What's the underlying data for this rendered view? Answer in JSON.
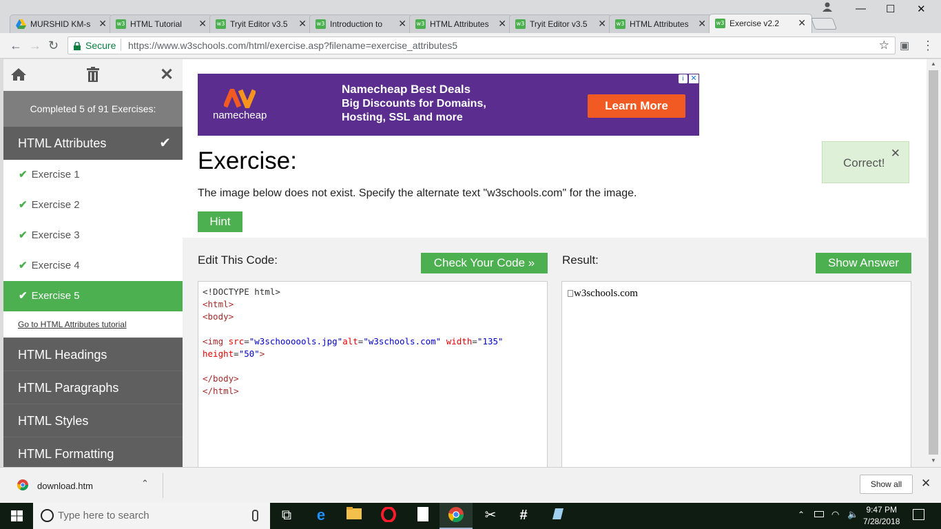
{
  "browser": {
    "tabs": [
      {
        "label": "MURSHID KM-s",
        "icon": "google-drive-icon"
      },
      {
        "label": "HTML Tutorial",
        "icon": "w3schools-icon"
      },
      {
        "label": "Tryit Editor v3.5",
        "icon": "w3schools-icon"
      },
      {
        "label": "Introduction to",
        "icon": "w3schools-icon"
      },
      {
        "label": "HTML Attributes",
        "icon": "w3schools-icon"
      },
      {
        "label": "Tryit Editor v3.5",
        "icon": "w3schools-icon"
      },
      {
        "label": "HTML Attributes",
        "icon": "w3schools-icon"
      },
      {
        "label": "Exercise v2.2",
        "icon": "w3schools-icon",
        "active": true
      }
    ],
    "secure_label": "Secure",
    "url": "https://www.w3schools.com/html/exercise.asp?filename=exercise_attributes5"
  },
  "sidebar": {
    "progress": "Completed 5 of 91 Exercises:",
    "section": "HTML Attributes",
    "exercises": [
      {
        "label": "Exercise 1"
      },
      {
        "label": "Exercise 2"
      },
      {
        "label": "Exercise 3"
      },
      {
        "label": "Exercise 4"
      },
      {
        "label": "Exercise 5",
        "active": true
      }
    ],
    "tutorial_link": "Go to HTML Attributes tutorial",
    "topics": [
      "HTML Headings",
      "HTML Paragraphs",
      "HTML Styles",
      "HTML Formatting"
    ]
  },
  "ad": {
    "brand": "namecheap",
    "title": "Namecheap Best Deals",
    "line1": "Big Discounts for Domains,",
    "line2": "Hosting, SSL and more",
    "cta": "Learn More"
  },
  "exercise": {
    "heading": "Exercise:",
    "instruction": "The image below does not exist. Specify the alternate text \"w3schools.com\" for the image.",
    "hint": "Hint",
    "correct": "Correct!",
    "edit_label": "Edit This Code:",
    "check_button": "Check Your Code »",
    "result_label": "Result:",
    "answer_button": "Show Answer",
    "result_alt_text": "w3schools.com"
  },
  "code": {
    "doctype": "<!DOCTYPE html>",
    "html_open": "<html>",
    "body_open": "<body>",
    "img_tag_open": "<img ",
    "src_attr": "src",
    "src_val": "\"w3schoooools.jpg\"",
    "alt_attr": "alt",
    "alt_val": "\"w3schools.com\"",
    "width_attr": "width",
    "width_val": "\"135\"",
    "height_attr": "height",
    "height_val": "\"50\"",
    "tag_close": ">",
    "eq": "=",
    "body_close": "</body>",
    "html_close": "</html>"
  },
  "downloads": {
    "file": "download.htm",
    "show_all": "Show all"
  },
  "taskbar": {
    "search_placeholder": "Type here to search",
    "time": "9:47 PM",
    "date": "7/28/2018"
  }
}
